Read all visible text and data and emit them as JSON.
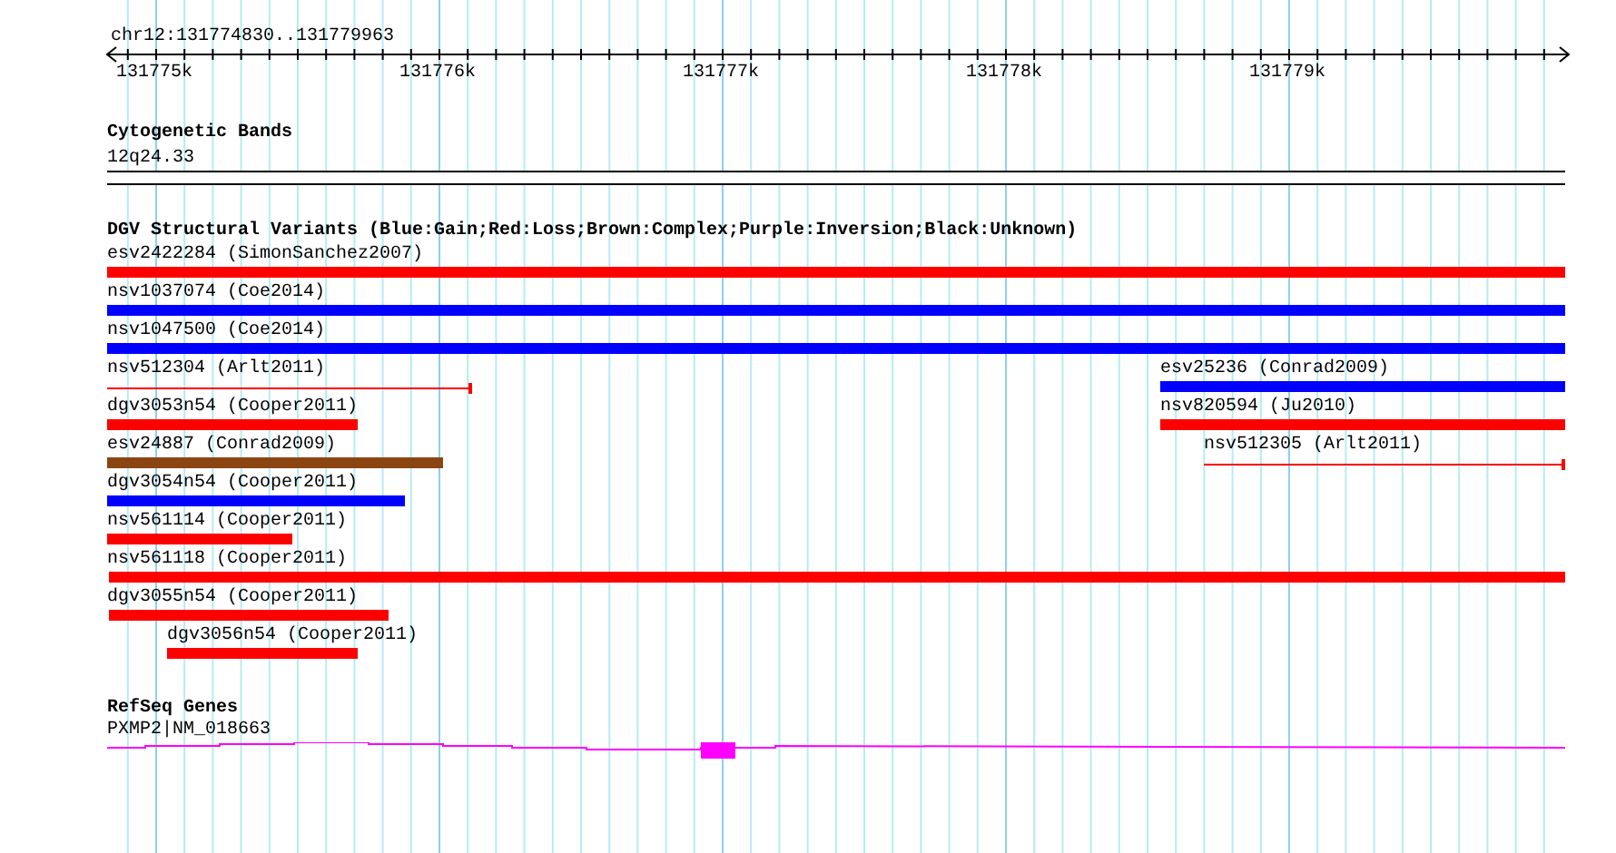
{
  "ruler": {
    "range": "chr12:131774830..131779963",
    "ticks": [
      "131775k",
      "131776k",
      "131777k",
      "131778k",
      "131779k"
    ]
  },
  "tracks": [
    {
      "title": "Cytogenetic Bands",
      "features": [
        {
          "label": "12q24.33",
          "kind": "band"
        }
      ]
    },
    {
      "title": "DGV Structural Variants (Blue:Gain;Red:Loss;Brown:Complex;Purple:Inversion;Black:Unknown)",
      "features": [
        {
          "label": "esv2422284 (SimonSanchez2007)",
          "kind": "loss"
        },
        {
          "label": "nsv1037074 (Coe2014)",
          "kind": "gain"
        },
        {
          "label": "nsv1047500 (Coe2014)",
          "kind": "gain"
        },
        {
          "label": "nsv512304 (Arlt2011)",
          "kind": "loss-line"
        },
        {
          "label": "esv25236 (Conrad2009)",
          "kind": "gain"
        },
        {
          "label": "dgv3053n54 (Cooper2011)",
          "kind": "loss"
        },
        {
          "label": "nsv820594 (Ju2010)",
          "kind": "loss"
        },
        {
          "label": "esv24887 (Conrad2009)",
          "kind": "complex"
        },
        {
          "label": "nsv512305 (Arlt2011)",
          "kind": "loss-line"
        },
        {
          "label": "dgv3054n54 (Cooper2011)",
          "kind": "gain"
        },
        {
          "label": "nsv561114 (Cooper2011)",
          "kind": "loss"
        },
        {
          "label": "nsv561118 (Cooper2011)",
          "kind": "loss"
        },
        {
          "label": "dgv3055n54 (Cooper2011)",
          "kind": "loss"
        },
        {
          "label": "dgv3056n54 (Cooper2011)",
          "kind": "loss"
        }
      ]
    },
    {
      "title": "RefSeq Genes",
      "features": [
        {
          "label": "PXMP2|NM_018663",
          "kind": "gene"
        }
      ]
    }
  ]
}
